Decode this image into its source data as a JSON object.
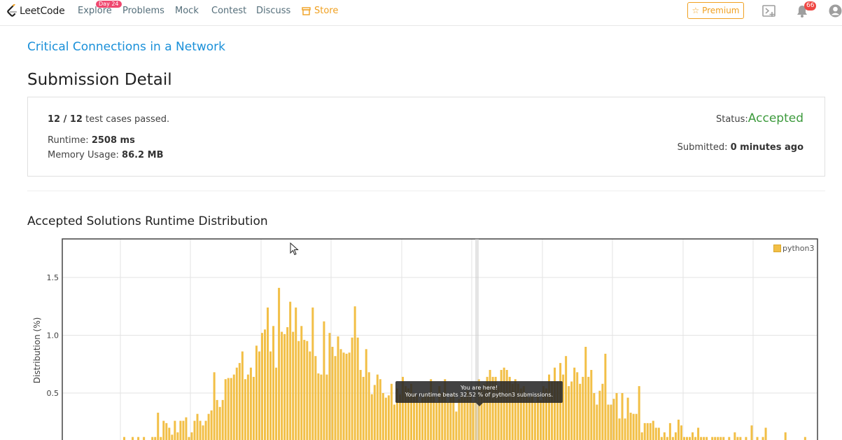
{
  "nav": {
    "logo_text": "LeetCode",
    "items": [
      {
        "label": "Explore",
        "badge": "Day 24"
      },
      {
        "label": "Problems"
      },
      {
        "label": "Mock"
      },
      {
        "label": "Contest"
      },
      {
        "label": "Discuss"
      },
      {
        "label": "Store"
      }
    ],
    "premium_label": "Premium",
    "notification_count": "66",
    "brand_color": "#f0a020"
  },
  "problem": {
    "title": "Critical Connections in a Network"
  },
  "page_title": "Submission Detail",
  "submission": {
    "tests_passed": "12 / 12",
    "tests_suffix": " test cases passed.",
    "runtime_label": "Runtime: ",
    "runtime_value": "2508 ms",
    "memory_label": "Memory Usage: ",
    "memory_value": "86.2 MB",
    "status_label": "Status: ",
    "status_value": "Accepted",
    "status_color": "#3c9a3c",
    "submitted_label": "Submitted: ",
    "submitted_value": "0 minutes ago"
  },
  "section_title": "Accepted Solutions Runtime Distribution",
  "chart_data": {
    "type": "bar",
    "title": "",
    "xlabel": "",
    "ylabel": "Distribution (%)",
    "ylim_visible": [
      0.15,
      1.82
    ],
    "yticks": [
      "0.5",
      "1.0",
      "1.5"
    ],
    "legend": "top-right",
    "series": [
      {
        "name": "python3",
        "color": "#f2bf46",
        "values": [
          0.12,
          0,
          0,
          0.12,
          0,
          0.12,
          0,
          0.12,
          0,
          0,
          0.12,
          0.12,
          0.33,
          0.12,
          0.26,
          0.24,
          0.2,
          0.14,
          0.26,
          0.16,
          0.26,
          0.26,
          0.29,
          0.12,
          0.16,
          0.26,
          0.32,
          0.26,
          0.22,
          0.26,
          0.32,
          0.35,
          0.68,
          0.44,
          0.38,
          0.44,
          0.62,
          0.63,
          0.63,
          0.66,
          0.72,
          0.76,
          0.86,
          0.62,
          0.66,
          0.72,
          0.64,
          0.91,
          0.86,
          1.02,
          1.05,
          1.24,
          0.86,
          1.08,
          0.72,
          1.41,
          1.03,
          1.01,
          1.07,
          1.29,
          1.03,
          1.24,
          0.95,
          1.08,
          0.96,
          0.95,
          0.86,
          1.24,
          0.82,
          0.67,
          0.66,
          1.12,
          0.66,
          1.02,
          0.9,
          0.82,
          0.99,
          0.88,
          0.85,
          0.84,
          0.85,
          0.98,
          1.25,
          0.98,
          0.7,
          0.64,
          0.88,
          0.68,
          0.49,
          0.57,
          0.66,
          0.62,
          0.5,
          0.46,
          0.48,
          0.58,
          0.4,
          0.54,
          0.49,
          0.64,
          0.56,
          0.54,
          0.58,
          0.5,
          0.48,
          0.42,
          0.46,
          0.5,
          0.48,
          0.62,
          0.47,
          0.42,
          0.56,
          0.5,
          0.62,
          0.42,
          0.46,
          0.5,
          0.34,
          0.45,
          0.48,
          0.46,
          0.52,
          0.5,
          0.42,
          0.56,
          0.62,
          0.54,
          0.58,
          0.64,
          0.7,
          0.64,
          0.64,
          0.56,
          0.7,
          0.72,
          0.7,
          0.64,
          0.58,
          0.62,
          0.58,
          0.54,
          0.56,
          0.5,
          0.46,
          0.48,
          0.42,
          0.5,
          0.44,
          0.56,
          0.54,
          0.66,
          0.6,
          0.72,
          0.6,
          0.76,
          0.66,
          0.82,
          0.56,
          0.6,
          0.72,
          0.68,
          0.58,
          0.64,
          0.9,
          0.64,
          0.7,
          0.5,
          0.4,
          0.52,
          0.58,
          0.84,
          0.4,
          0.4,
          0.45,
          0.5,
          0.28,
          0.5,
          0.28,
          0.46,
          0.33,
          0.32,
          0.32,
          0.56,
          0.16,
          0.24,
          0.24,
          0.24,
          0.26,
          0.2,
          0.2,
          0.12,
          0.16,
          0.12,
          0.24,
          0.12,
          0.16,
          0.27,
          0.22,
          0.12,
          0.12,
          0.12,
          0.16,
          0.12,
          0.2,
          0.12,
          0.12,
          0.12,
          0,
          0.12,
          0.12,
          0.12,
          0.12,
          0.12,
          0,
          0.12,
          0,
          0.16,
          0.12,
          0.12,
          0,
          0.12,
          0,
          0.22,
          0,
          0.12,
          0,
          0.12,
          0.2,
          0,
          0,
          0,
          0,
          0,
          0,
          0.16,
          0,
          0,
          0,
          0,
          0,
          0,
          0.12,
          0,
          0,
          0,
          0,
          0,
          0,
          0.12,
          0,
          0.12
        ]
      }
    ]
  },
  "tooltip": {
    "line1": "You are here!",
    "line2": "Your runtime beats 32.52 % of python3 submissions."
  }
}
